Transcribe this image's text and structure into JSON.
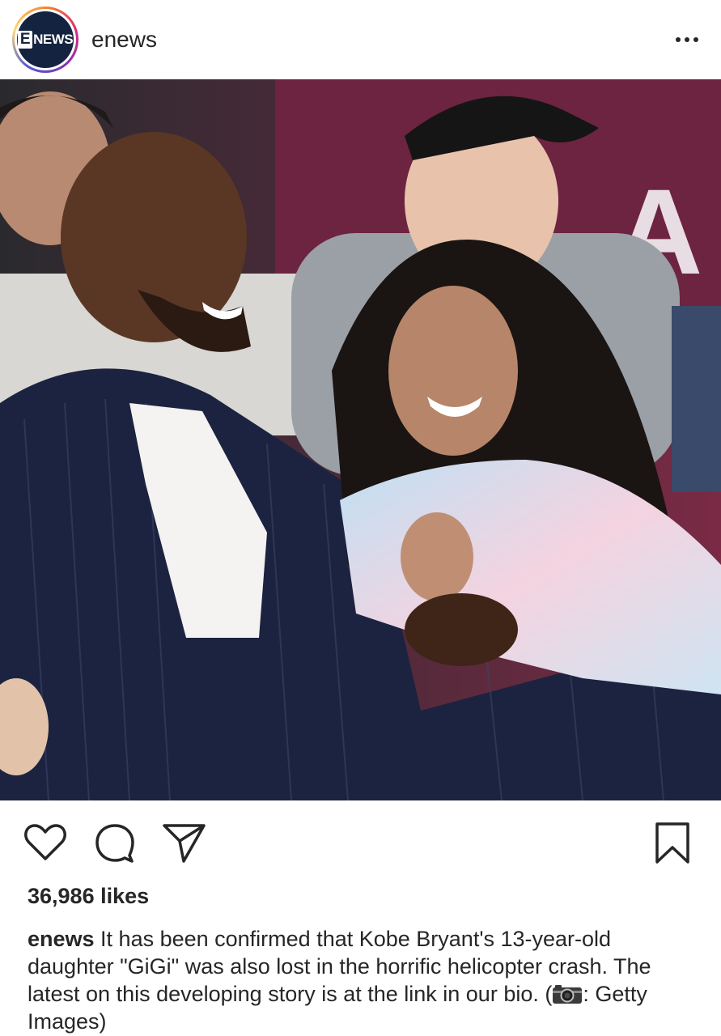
{
  "header": {
    "avatar_text": "NEWS",
    "avatar_badge": "E",
    "username": "enews",
    "more_label": "More options"
  },
  "icons": {
    "like": "heart-icon",
    "comment": "comment-icon",
    "share": "paper-plane-icon",
    "save": "bookmark-icon",
    "more": "ellipsis-icon",
    "camera": "camera-emoji"
  },
  "post": {
    "likes": "36,986 likes",
    "caption_user": "enews",
    "caption_text": " It has been confirmed that Kobe Bryant's 13-year-old daughter \"GiGi\" was also lost in the horrific helicopter crash. The latest on this developing story is at the link in our bio. (",
    "caption_credit": ": Getty Images)"
  },
  "colors": {
    "text": "#262626",
    "background": "#ffffff",
    "avatar_bg": "#14233f"
  }
}
